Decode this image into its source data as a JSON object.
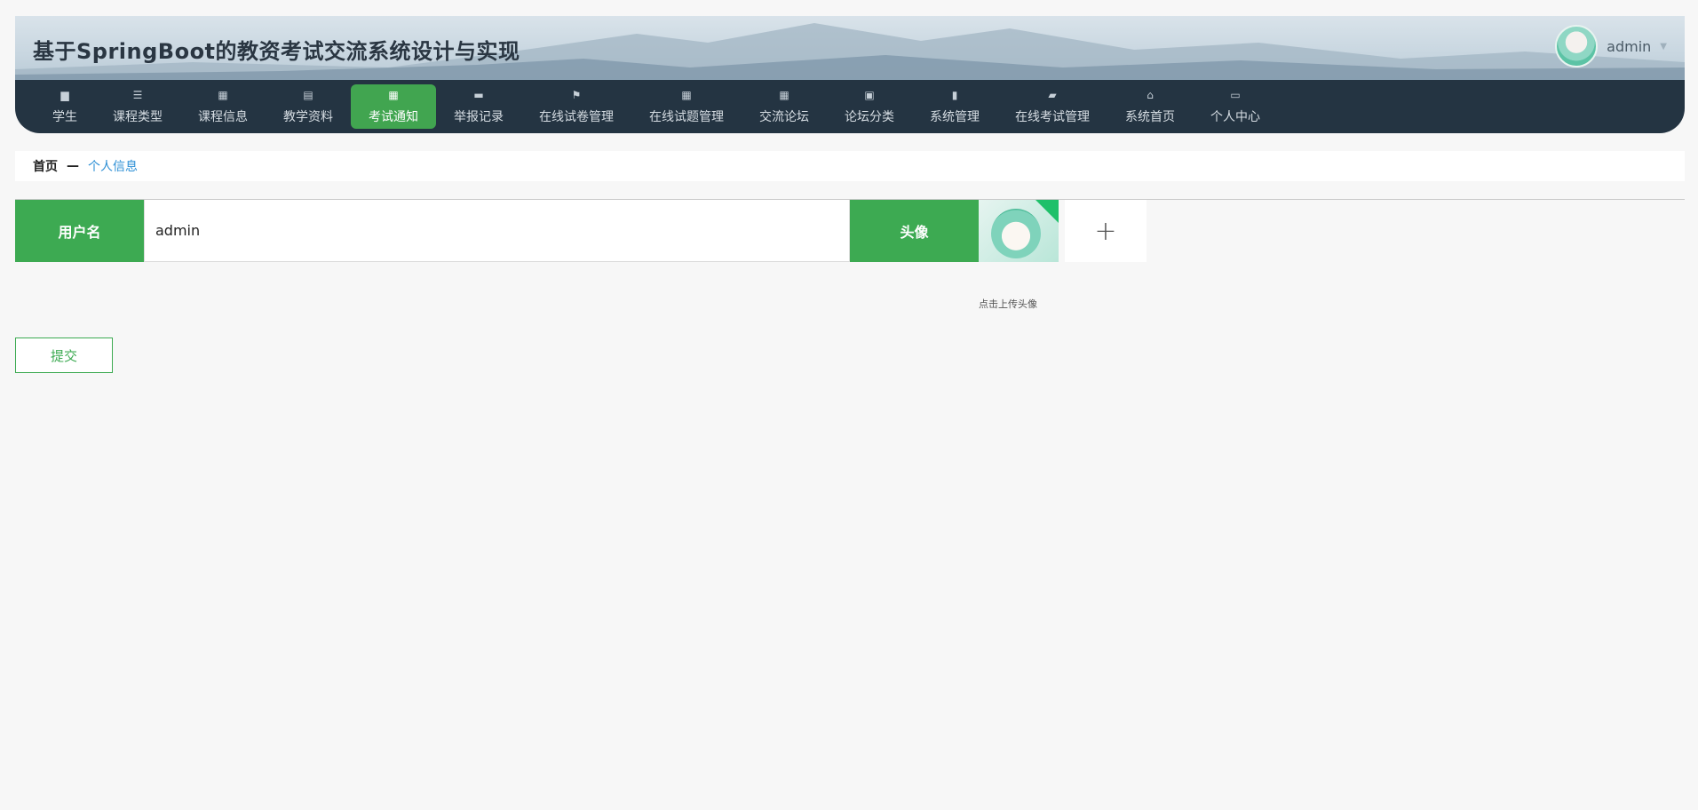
{
  "app": {
    "title": "基于SpringBoot的教资考试交流系统设计与实现"
  },
  "user": {
    "name": "admin"
  },
  "nav": {
    "items": [
      {
        "label": "学生",
        "icon": "user-card-icon"
      },
      {
        "label": "课程类型",
        "icon": "sliders-icon"
      },
      {
        "label": "课程信息",
        "icon": "grid-icon"
      },
      {
        "label": "教学资料",
        "icon": "clipboard-icon"
      },
      {
        "label": "考试通知",
        "icon": "grid-icon",
        "active": true
      },
      {
        "label": "举报记录",
        "icon": "mailbox-icon"
      },
      {
        "label": "在线试卷管理",
        "icon": "flag-icon"
      },
      {
        "label": "在线试题管理",
        "icon": "grid-icon"
      },
      {
        "label": "交流论坛",
        "icon": "grid-icon"
      },
      {
        "label": "论坛分类",
        "icon": "chart-icon"
      },
      {
        "label": "系统管理",
        "icon": "bar-chart-icon"
      },
      {
        "label": "在线考试管理",
        "icon": "ticket-icon"
      },
      {
        "label": "系统首页",
        "icon": "home-icon"
      },
      {
        "label": "个人中心",
        "icon": "wallet-icon"
      }
    ]
  },
  "breadcrumb": {
    "home": "首页",
    "separator": "—",
    "current": "个人信息"
  },
  "form": {
    "username_label": "用户名",
    "username_value": "admin",
    "avatar_label": "头像",
    "upload_symbol": "+",
    "upload_hint": "点击上传头像",
    "submit_label": "提交"
  },
  "colors": {
    "accent": "#3daa52",
    "nav_bg": "#243442",
    "link": "#2d8fd5"
  }
}
